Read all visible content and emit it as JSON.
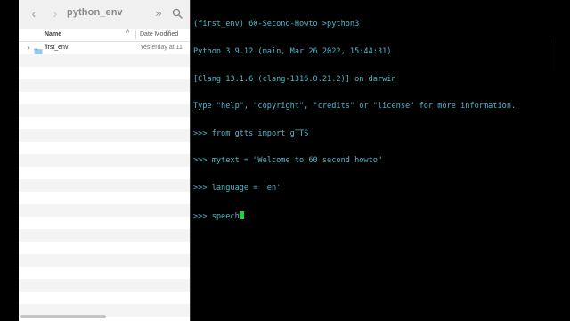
{
  "finder": {
    "title": "python_env",
    "toolbar": {
      "back_icon": "chevron-left-icon",
      "forward_icon": "chevron-right-icon",
      "more_label": "»",
      "search_icon": "search-icon"
    },
    "columns": {
      "name": "Name",
      "sort_indicator": "^",
      "date": "Date Modified"
    },
    "items": [
      {
        "icon": "folder-icon",
        "name": "first_env",
        "date": "Yesterday at 11"
      }
    ],
    "empty_row_count": 21
  },
  "terminal": {
    "lines": [
      "(first_env) 60-Second-Howto >python3",
      "Python 3.9.12 (main, Mar 26 2022, 15:44:31)",
      "[Clang 13.1.6 (clang-1316.0.21.2)] on darwin",
      "Type \"help\", \"copyright\", \"credits\" or \"license\" for more information.",
      ">>> from gtts import gTTS",
      ">>> mytext = \"Welcome to 60 second howto\"",
      ">>> language = 'en'"
    ],
    "current_input": ">>> speech",
    "colors": {
      "text": "#4fb8c9",
      "cursor": "#19d43e",
      "background": "#000000"
    }
  }
}
